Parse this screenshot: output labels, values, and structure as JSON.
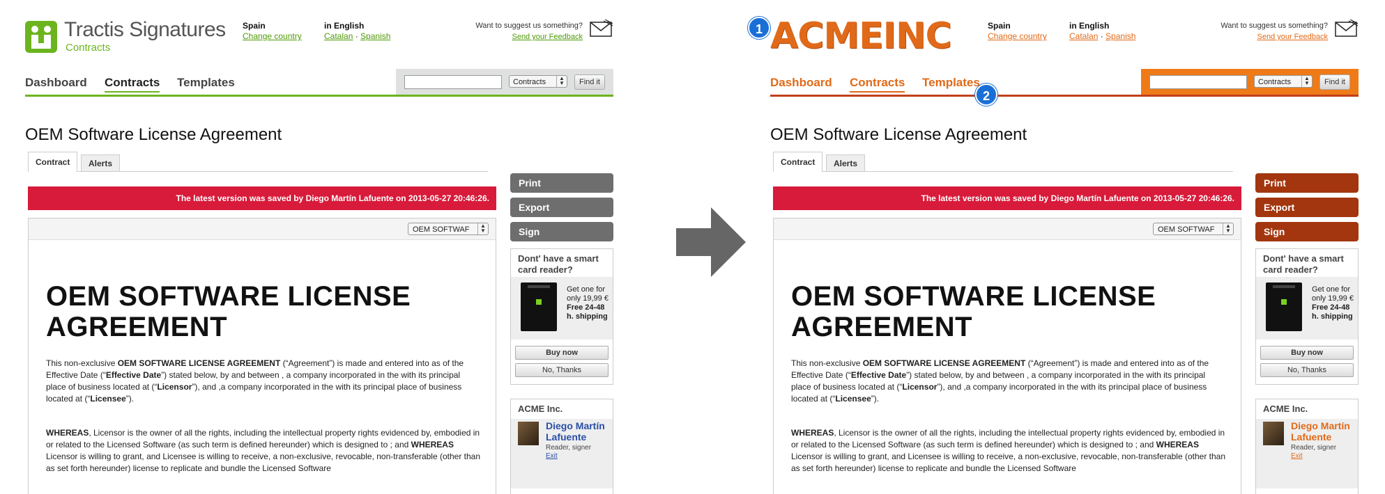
{
  "left": {
    "logo": {
      "name": "Tractis Signatures",
      "sub": "Contracts"
    },
    "header": {
      "country_label": "Spain",
      "country_link": "Change country",
      "lang_label": "in English",
      "lang_link_1": "Catalan",
      "lang_sep": " · ",
      "lang_link_2": "Spanish",
      "feedback_text": "Want to suggest us something?",
      "feedback_link": "Send your Feedback"
    }
  },
  "right": {
    "logo": {
      "name": "ACMEINC"
    }
  },
  "nav": {
    "items": [
      "Dashboard",
      "Contracts",
      "Templates"
    ],
    "active": "Contracts"
  },
  "search": {
    "select_value": "Contracts",
    "button_label": "Find it"
  },
  "page": {
    "title": "OEM Software License Agreement",
    "tabs": [
      "Contract",
      "Alerts"
    ],
    "banner": "The latest version was saved by Diego Martín Lafuente on 2013-05-27 20:46:26.",
    "doc_select": "OEM SOFTWAF",
    "doc_heading": "OEM SOFTWARE LICENSE AGREEMENT"
  },
  "sidebar": {
    "buttons": [
      "Print",
      "Export",
      "Sign"
    ],
    "promo": {
      "title": "Dont' have a smart card reader?",
      "text_line1": "Get one for only 19,99 €",
      "text_bold": "Free 24-48 h. shipping",
      "buy": "Buy now",
      "no": "No, Thanks"
    },
    "user": {
      "org": "ACME Inc.",
      "name": "Diego Martín Lafuente",
      "role": "Reader, signer",
      "exit": "Exit"
    }
  },
  "callouts": [
    "1",
    "2"
  ],
  "colors": {
    "tractis_green": "#6cb41e",
    "acme_orange": "#e06a19",
    "acme_dark": "#a3360e",
    "banner_red": "#d81b3a",
    "callout_blue": "#1a6fd6"
  },
  "icons": [
    "envelope-icon",
    "select-arrows-icon",
    "card-reader-image",
    "avatar",
    "right-arrow-icon"
  ]
}
